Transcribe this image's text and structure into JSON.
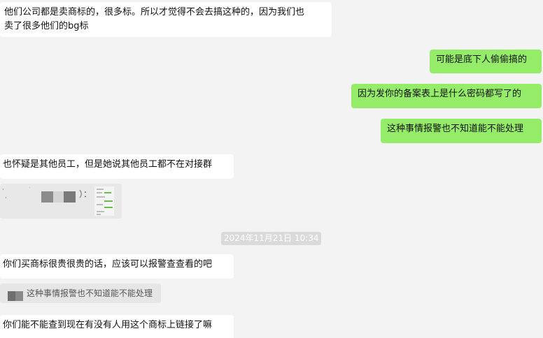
{
  "messages": {
    "m1": "他们公司都是卖商标的，很多标。所以才觉得不会去搞这种的，因为我们也",
    "m1b": "卖了很多他们的bg标",
    "m2": "可能是底下人偷偷搞的",
    "m3": "因为发你的备案表上是什么密码都写了的",
    "m4": "这种事情报警也不知道能不能处理",
    "m5": "也怀疑是其他员工，但是她说其他员工都不在对接群",
    "img_colon": "）：",
    "timestamp": "2024年11月21日 10:34",
    "m6": "你们买商标很贵很贵的话，应该可以报警查查看的吧",
    "quote_text": "这种事情报警也不知道能不能处理",
    "m7": "你们能不能查到现在有没有人用这个商标上链接了嘛"
  },
  "colors": {
    "background": "#f3f3f3",
    "incoming_bubble": "#ffffff",
    "outgoing_bubble": "#95ec69",
    "timestamp_bg": "#dadada"
  }
}
